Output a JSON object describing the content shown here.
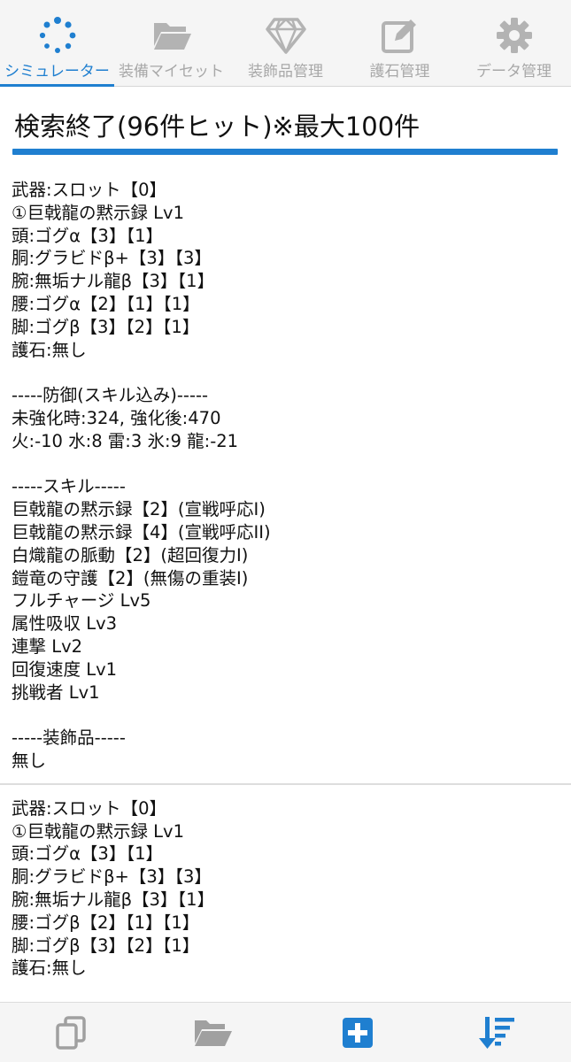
{
  "tabs": [
    {
      "label": "シミュレーター",
      "icon": "spinner-icon",
      "active": true
    },
    {
      "label": "装備マイセット",
      "icon": "folder-open-icon",
      "active": false
    },
    {
      "label": "装飾品管理",
      "icon": "gem-icon",
      "active": false
    },
    {
      "label": "護石管理",
      "icon": "edit-icon",
      "active": false
    },
    {
      "label": "データ管理",
      "icon": "gear-icon",
      "active": false
    }
  ],
  "header": {
    "title": "検索終了(96件ヒット)※最大100件"
  },
  "results": [
    {
      "weapon": "武器:スロット【0】",
      "rampage": "①巨戟龍の黙示録 Lv1",
      "head": "頭:ゴグα【3】【1】",
      "chest": "胴:グラビドβ+【3】【3】",
      "arms": "腕:無垢ナル龍β【3】【1】",
      "waist": "腰:ゴグα【2】【1】【1】",
      "legs": "脚:ゴグβ【3】【2】【1】",
      "talisman": "護石:無し",
      "defense_heading": "-----防御(スキル込み)-----",
      "defense_values": "未強化時:324, 強化後:470",
      "resistances": "火:-10 水:8 雷:3 氷:9 龍:-21",
      "skills_heading": "-----スキル-----",
      "skills": [
        "巨戟龍の黙示録【2】(宣戦呼応I)",
        "巨戟龍の黙示録【4】(宣戦呼応II)",
        "白熾龍の脈動【2】(超回復力I)",
        "鎧竜の守護【2】(無傷の重装I)",
        "フルチャージ Lv5",
        "属性吸収 Lv3",
        "連撃 Lv2",
        "回復速度 Lv1",
        "挑戦者 Lv1"
      ],
      "decorations_heading": "-----装飾品-----",
      "decorations": "無し"
    },
    {
      "weapon": "武器:スロット【0】",
      "rampage": "①巨戟龍の黙示録 Lv1",
      "head": "頭:ゴグα【3】【1】",
      "chest": "胴:グラビドβ+【3】【3】",
      "arms": "腕:無垢ナル龍β【3】【1】",
      "waist": "腰:ゴグβ【2】【1】【1】",
      "legs": "脚:ゴグβ【3】【2】【1】",
      "talisman": "護石:無し"
    }
  ],
  "bottom_bar": [
    {
      "icon": "copy-icon"
    },
    {
      "icon": "folder-open-icon"
    },
    {
      "icon": "plus-square-icon"
    },
    {
      "icon": "sort-descending-icon"
    }
  ],
  "colors": {
    "accent": "#1f7fd0",
    "inactive": "#a8a8a8",
    "bar_bg": "#f5f5f5"
  }
}
